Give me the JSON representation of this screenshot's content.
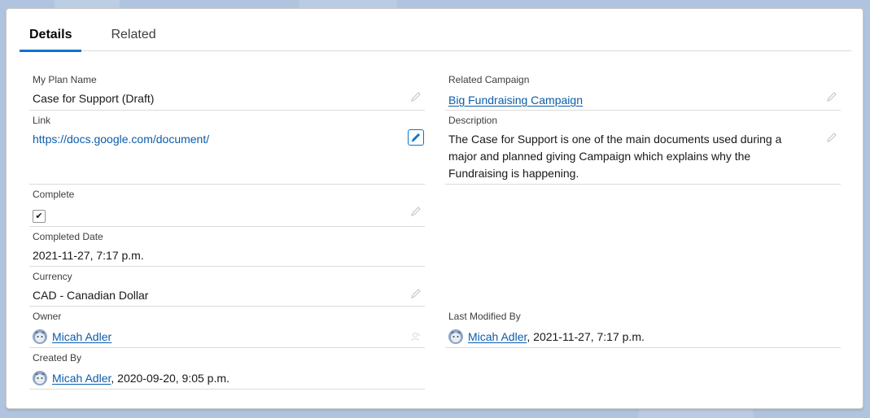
{
  "tabs": [
    {
      "label": "Details",
      "active": true
    },
    {
      "label": "Related",
      "active": false
    }
  ],
  "fields": {
    "plan_name": {
      "label": "My Plan Name",
      "value": "Case for Support (Draft)"
    },
    "related_campaign": {
      "label": "Related Campaign",
      "value": "Big Fundraising Campaign"
    },
    "link": {
      "label": "Link",
      "value": "https://docs.google.com/document/"
    },
    "description": {
      "label": "Description",
      "value": "The Case for Support is one of the main documents used during a major and planned giving Campaign which explains why the Fundraising is happening."
    },
    "complete": {
      "label": "Complete",
      "checked": true,
      "check_glyph": "✔"
    },
    "completed_date": {
      "label": "Completed Date",
      "value": "2021-11-27, 7:17 p.m."
    },
    "currency": {
      "label": "Currency",
      "value": "CAD - Canadian Dollar"
    },
    "owner": {
      "label": "Owner",
      "name": "Micah Adler"
    },
    "last_modified": {
      "label": "Last Modified By",
      "name": "Micah Adler",
      "date": ", 2021-11-27, 7:17 p.m."
    },
    "created_by": {
      "label": "Created By",
      "name": "Micah Adler",
      "date": ", 2020-09-20, 9:05 p.m."
    }
  },
  "icons": {
    "edit": "pencil-icon",
    "change_owner": "change-owner-icon",
    "avatar": "user-avatar-icon"
  },
  "colors": {
    "accent": "#0176d3",
    "link": "#0b5cab",
    "border": "#dddbda",
    "background": "#b0c4df"
  }
}
